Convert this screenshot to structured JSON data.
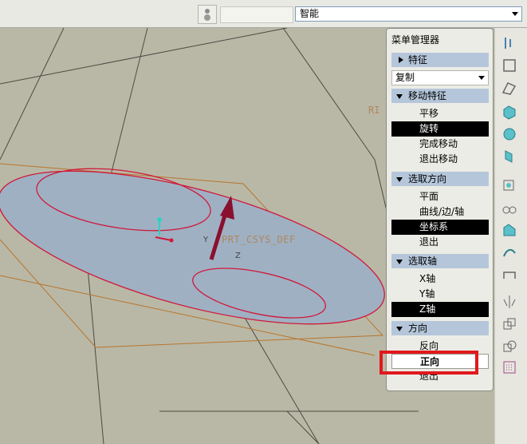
{
  "toolbar": {
    "filter_value": "智能"
  },
  "viewport": {
    "csys_label": "PRT_CSYS_DEF",
    "corner_label": "RI"
  },
  "menu_manager": {
    "title": "菜单管理器",
    "feature_section": "特征",
    "feature_dropdown": "复制",
    "move_section": "移动特征",
    "move_items": [
      "平移",
      "旋转",
      "完成移动",
      "退出移动"
    ],
    "direction_section": "选取方向",
    "direction_items": [
      "平面",
      "曲线/边/轴",
      "坐标系",
      "退出"
    ],
    "axis_section": "选取轴",
    "axis_items": [
      "X轴",
      "Y轴",
      "Z轴"
    ],
    "orient_section": "方向",
    "orient_items": [
      "反向",
      "正向",
      "退出"
    ]
  },
  "colors": {
    "highlight": "#e0191c",
    "section_bg": "#b5c6da",
    "selected_bg": "#000000",
    "arrow": "#8a1030",
    "ellipse": "#d0193a"
  }
}
